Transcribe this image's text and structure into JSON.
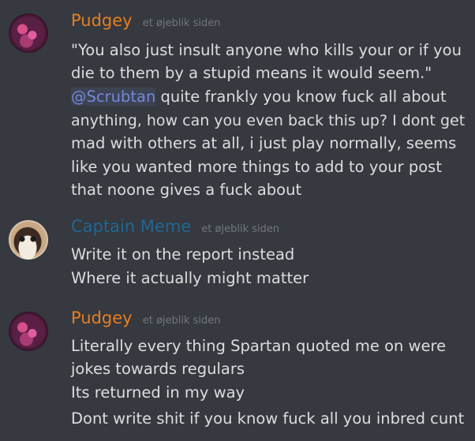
{
  "messages": [
    {
      "username": "Pudgey",
      "timestamp": "et øjeblik siden",
      "lines": [
        {
          "mention": "",
          "text": "\"You also just insult anyone who kills your or if you"
        },
        {
          "mention": "",
          "text": "die to them by a stupid means it would seem.\""
        },
        {
          "mention": "@Scrubtan",
          "text": " quite frankly you know fuck all about"
        },
        {
          "mention": "",
          "text": "anything, how can you even back this up? I dont get"
        },
        {
          "mention": "",
          "text": "mad with others at all, i just play normally, seems"
        },
        {
          "mention": "",
          "text": "like you wanted more things to add to your post"
        },
        {
          "mention": "",
          "text": "that noone gives a fuck about"
        }
      ]
    },
    {
      "username": "Captain Meme",
      "timestamp": "et øjeblik siden",
      "lines": [
        {
          "mention": "",
          "text": "Write it on the report instead"
        },
        {
          "mention": "",
          "text": "Where it actually might matter"
        }
      ]
    },
    {
      "username": "Pudgey",
      "timestamp": "et øjeblik siden",
      "lines": [
        {
          "mention": "",
          "text": "Literally every thing Spartan quoted me on were"
        },
        {
          "mention": "",
          "text": "jokes towards regulars"
        },
        {
          "mention": "",
          "text": "Its returned in my way"
        },
        {
          "mention": "",
          "text": "Dont write shit if you know fuck all you inbred cunt"
        }
      ]
    }
  ]
}
